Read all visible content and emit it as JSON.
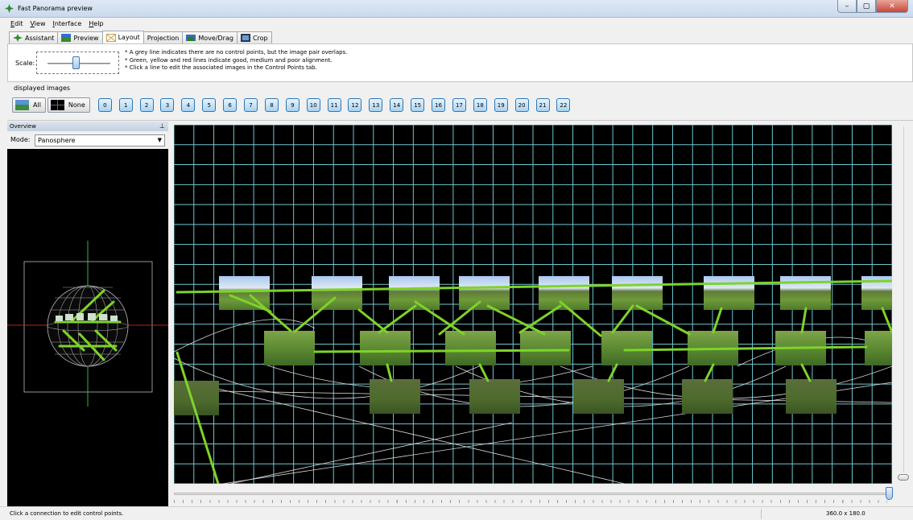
{
  "window": {
    "title": "Fast Panorama preview",
    "controls": [
      "–",
      "▢",
      "✕"
    ]
  },
  "menu": [
    "Edit",
    "View",
    "Interface",
    "Help"
  ],
  "tabs": [
    {
      "label": "Assistant",
      "icon": "assistant-icon",
      "active": false
    },
    {
      "label": "Preview",
      "icon": "preview-icon",
      "active": false
    },
    {
      "label": "Layout",
      "icon": "layout-icon",
      "active": true
    },
    {
      "label": "Projection",
      "icon": "",
      "active": false
    },
    {
      "label": "Move/Drag",
      "icon": "move-icon",
      "active": false
    },
    {
      "label": "Crop",
      "icon": "crop-icon",
      "active": false
    }
  ],
  "layout": {
    "scale_label": "Scale:",
    "hints": [
      "* A grey line indicates there are no control points, but the image pair overlaps.",
      "* Green, yellow and red lines indicate good, medium and poor alignment.",
      "* Click a line to edit the associated images in the Control Points tab."
    ]
  },
  "displayed_images": {
    "label": "displayed images",
    "all_label": "All",
    "none_label": "None",
    "numbers": [
      "0",
      "1",
      "2",
      "3",
      "4",
      "5",
      "6",
      "7",
      "8",
      "9",
      "10",
      "11",
      "12",
      "13",
      "14",
      "15",
      "16",
      "17",
      "18",
      "19",
      "20",
      "21",
      "22"
    ]
  },
  "overview": {
    "title": "Overview",
    "mode_label": "Mode:",
    "mode_value": "Panosphere"
  },
  "status": {
    "left": "Click a connection to edit control points.",
    "right": "360.0 x 180.0"
  },
  "colors": {
    "grid": "#6fc7cf",
    "good_link": "#7ed32a",
    "no_cp_link": "#cccccc",
    "tab_active": "#ffffff",
    "number_button": "#a8d3f2"
  }
}
